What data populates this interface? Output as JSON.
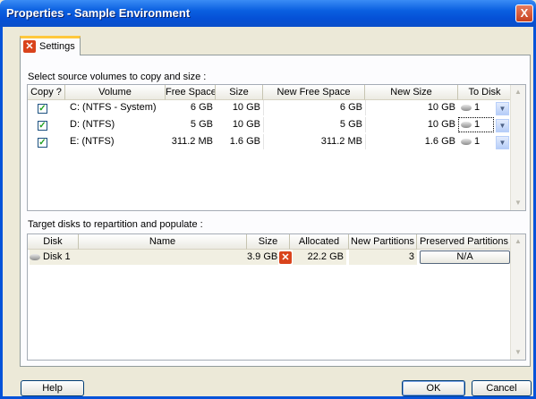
{
  "window": {
    "title": "Properties - Sample Environment",
    "close_glyph": "X"
  },
  "tab": {
    "label": "Settings",
    "icon": "settings-x-icon"
  },
  "source": {
    "label": "Select source volumes to copy and size :",
    "columns": [
      "Copy ?",
      "Volume",
      "Free Space",
      "Size",
      "New Free Space",
      "New Size",
      "To Disk"
    ],
    "rows": [
      {
        "copy": true,
        "volume": "C: (NTFS - System)",
        "free": "6 GB",
        "size": "10 GB",
        "new_free": "6 GB",
        "new_size": "10 GB",
        "to_disk": "1"
      },
      {
        "copy": true,
        "volume": "D: (NTFS)",
        "free": "5 GB",
        "size": "10 GB",
        "new_free": "5 GB",
        "new_size": "10 GB",
        "to_disk": "1"
      },
      {
        "copy": true,
        "volume": "E: (NTFS)",
        "free": "311.2 MB",
        "size": "1.6 GB",
        "new_free": "311.2 MB",
        "new_size": "1.6 GB",
        "to_disk": "1"
      }
    ]
  },
  "target": {
    "label": "Target disks to repartition and populate :",
    "columns": [
      "Disk",
      "Name",
      "Size",
      "Allocated",
      "New Partitions",
      "Preserved Partitions"
    ],
    "rows": [
      {
        "disk": "Disk 1",
        "name": "",
        "size": "3.9 GB",
        "allocated": "22.2 GB",
        "new_partitions": "3",
        "preserved": "N/A"
      }
    ]
  },
  "buttons": {
    "help": "Help",
    "ok": "OK",
    "cancel": "Cancel"
  },
  "colors": {
    "titlebar": "#0a5fe0",
    "tab_highlight": "#ffc83c",
    "error_icon": "#d9431c",
    "checkmark": "#21a121"
  }
}
